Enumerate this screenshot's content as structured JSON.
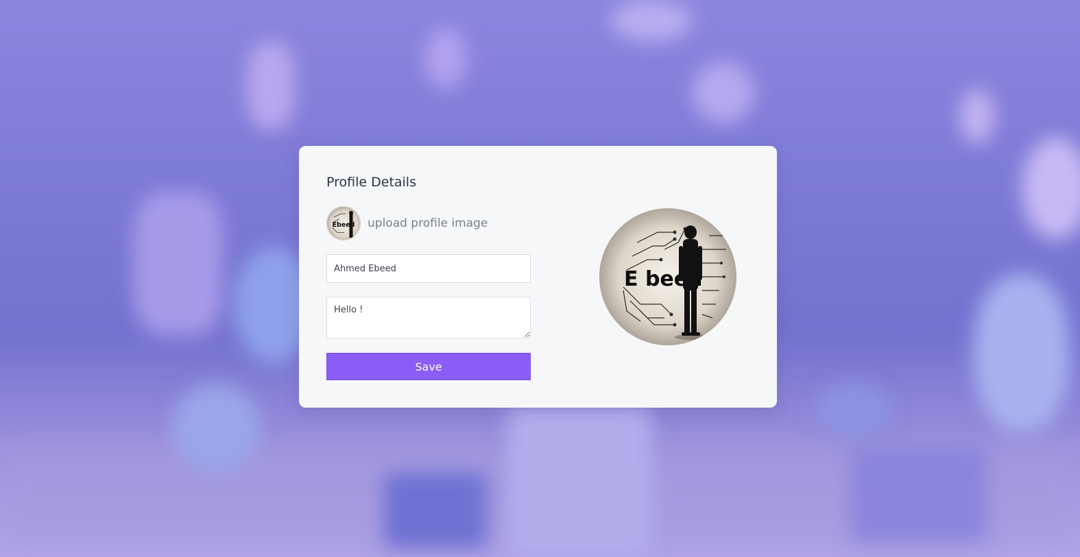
{
  "card": {
    "title": "Profile Details",
    "upload_label": "upload profile image",
    "name_value": "Ahmed Ebeed",
    "bio_value": "Hello !",
    "save_label": "Save"
  },
  "avatar": {
    "logo_text": "E beed"
  },
  "colors": {
    "accent": "#8b5cf6",
    "card_bg": "#f6f7f9"
  }
}
